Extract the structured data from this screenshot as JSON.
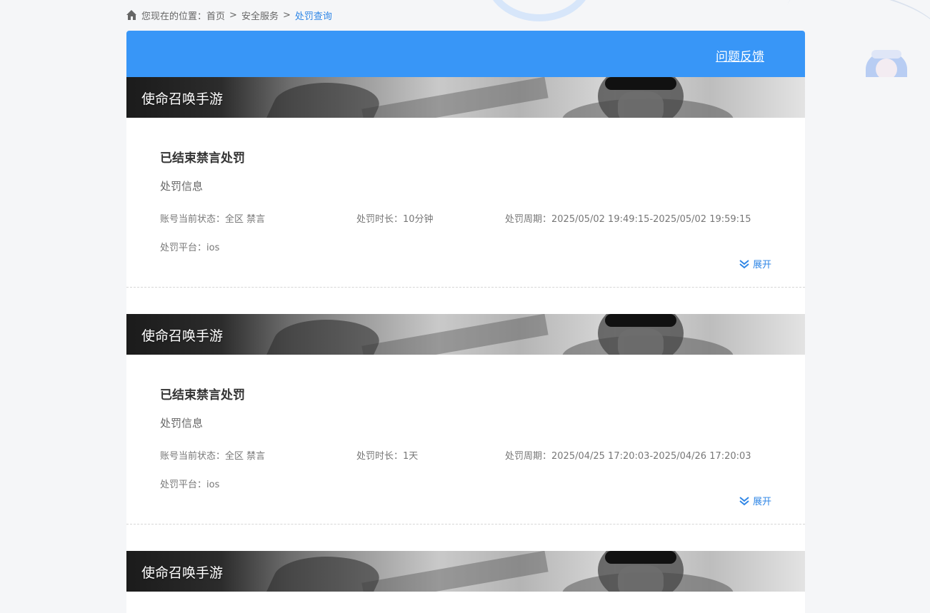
{
  "breadcrumb": {
    "prefix": "您现在的位置：",
    "items": [
      "首页",
      "安全服务"
    ],
    "current": "处罚查询",
    "separator": ">"
  },
  "header": {
    "feedback_label": "问题反馈",
    "accent_color": "#3896f7"
  },
  "records": [
    {
      "game": "使命召唤手游",
      "title": "已结束禁言处罚",
      "info_heading": "处罚信息",
      "status": "账号当前状态：全区 禁言",
      "duration": "处罚时长：10分钟",
      "period": "处罚周期：2025/05/02 19:49:15-2025/05/02 19:59:15",
      "platform": "处罚平台：ios",
      "expand_label": "展开"
    },
    {
      "game": "使命召唤手游",
      "title": "已结束禁言处罚",
      "info_heading": "处罚信息",
      "status": "账号当前状态：全区 禁言",
      "duration": "处罚时长：1天",
      "period": "处罚周期：2025/04/25 17:20:03-2025/04/26 17:20:03",
      "platform": "处罚平台：ios",
      "expand_label": "展开"
    },
    {
      "game": "使命召唤手游"
    }
  ],
  "icons": {
    "home": "home-icon",
    "expand": "double-chevron-down-icon"
  }
}
